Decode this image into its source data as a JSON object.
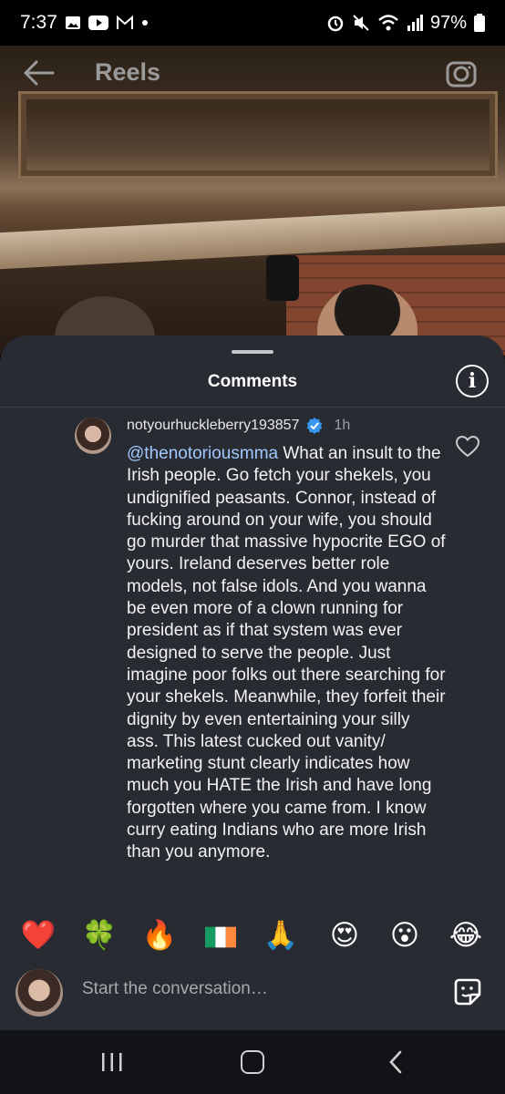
{
  "status_bar": {
    "time": "7:37",
    "left_icons": [
      "gallery-icon",
      "youtube-icon",
      "gmail-icon",
      "dot-icon"
    ],
    "right_icons": [
      "alarm-icon",
      "mute-icon",
      "wifi-icon",
      "signal-icon"
    ],
    "battery": "97%"
  },
  "header": {
    "title": "Reels",
    "back_icon": "arrow-left-icon",
    "camera_icon": "camera-icon"
  },
  "comments_sheet": {
    "title": "Comments",
    "info_glyph": "i",
    "comment": {
      "username": "notyourhuckleberry193857",
      "verified": true,
      "time": "1h",
      "mention": "@thenotoriousmma",
      "text": " What an insult to the Irish people. Go fetch your shekels, you undignified peasants. Connor, instead of fucking around on your wife, you should go murder that massive hypocrite EGO of yours. Ireland deserves better role models, not false idols. And you wanna be even more of a clown running for president as if that system was ever designed to serve the people. Just imagine poor folks out there searching for your shekels. Meanwhile, they forfeit their dignity by even entertaining your silly ass. This latest cucked out vanity/ marketing stunt clearly indicates how much you HATE the Irish and have long forgotten where you came from. I know curry eating Indians who are more Irish than you anymore."
    }
  },
  "reactions": [
    "❤️",
    "🍀",
    "🔥",
    "🇮🇪",
    "🙏",
    "😍",
    "😮",
    "😂"
  ],
  "compose": {
    "placeholder": "Start the conversation…"
  },
  "colors": {
    "sheet_bg": "#282b31",
    "mention": "#9fc8ff",
    "verified": "#3897f0"
  }
}
